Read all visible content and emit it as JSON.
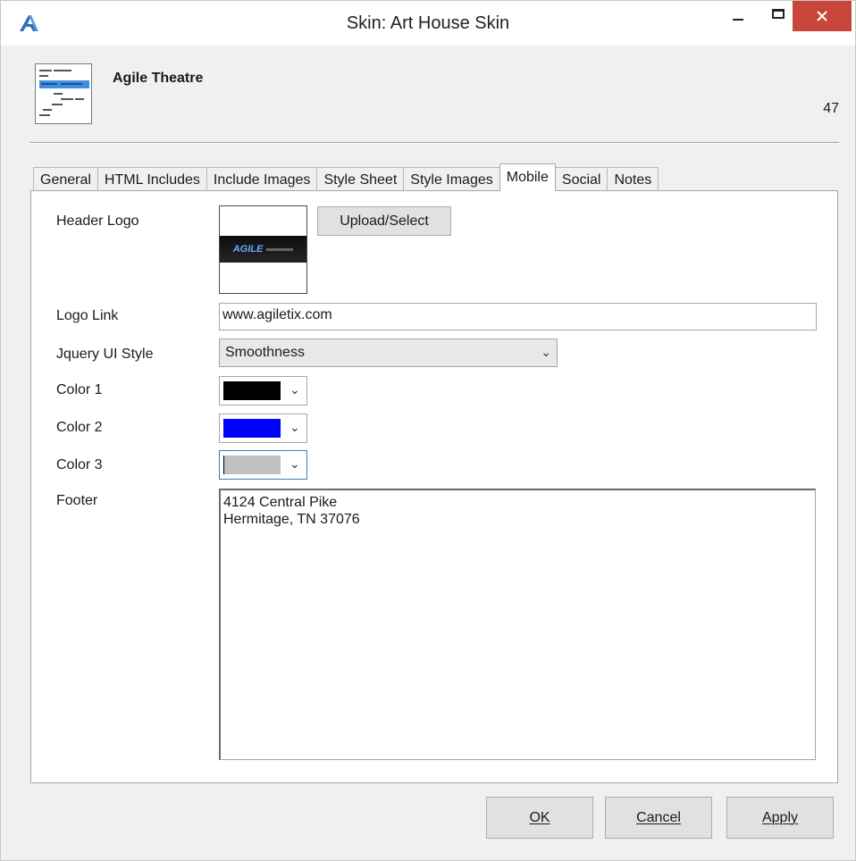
{
  "window": {
    "title": "Skin: Art House Skin",
    "icon": "agile-logo-icon",
    "controls": [
      "minimize-icon",
      "maximize-icon",
      "close-icon"
    ]
  },
  "header": {
    "name": "Agile Theatre",
    "id": "47",
    "icon": "skin-document-icon"
  },
  "tabs": [
    {
      "label": "General",
      "active": false
    },
    {
      "label": "HTML Includes",
      "active": false
    },
    {
      "label": "Include Images",
      "active": false
    },
    {
      "label": "Style Sheet",
      "active": false
    },
    {
      "label": "Style Images",
      "active": false
    },
    {
      "label": "Mobile",
      "active": true
    },
    {
      "label": "Social",
      "active": false
    },
    {
      "label": "Notes",
      "active": false
    }
  ],
  "mobile": {
    "header_logo_label": "Header Logo",
    "upload_button": "Upload/Select",
    "logo_link_label": "Logo Link",
    "logo_link_value": "www.agiletix.com",
    "jquery_label": "Jquery UI Style",
    "jquery_value": "Smoothness",
    "color1_label": "Color 1",
    "color1_value": "#000000",
    "color2_label": "Color 2",
    "color2_value": "#0000ff",
    "color3_label": "Color 3",
    "color3_value": "#c0c0c0",
    "footer_label": "Footer",
    "footer_value": "4124 Central Pike\nHermitage, TN  37076"
  },
  "buttons": {
    "ok": "OK",
    "cancel": "Cancel",
    "apply": "Apply"
  }
}
